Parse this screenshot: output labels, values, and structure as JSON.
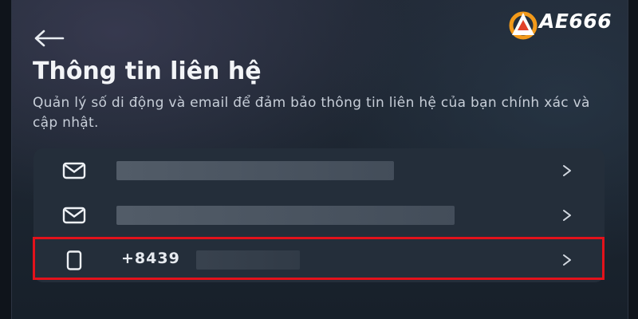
{
  "header": {
    "back_icon": "arrow-left-icon",
    "title": "Thông tin liên hệ",
    "subtitle": "Quản lý số di động và email để đảm bảo thông tin liên hệ của bạn chính xác và cập nhật."
  },
  "watermark": {
    "brand_text": "AE666",
    "accent_color": "#f39a1a"
  },
  "contacts": [
    {
      "type": "email",
      "icon": "mail-icon",
      "value": "",
      "redacted": true,
      "chevron": ">"
    },
    {
      "type": "email",
      "icon": "mail-icon",
      "value": "",
      "redacted": true,
      "chevron": ">"
    },
    {
      "type": "phone",
      "icon": "phone-icon",
      "value": "+8439",
      "redacted": true,
      "chevron": ">",
      "highlighted": true
    }
  ],
  "colors": {
    "highlight_border": "#e3121b",
    "card_background": "#242e3a",
    "title_text": "#f2f4f7"
  }
}
